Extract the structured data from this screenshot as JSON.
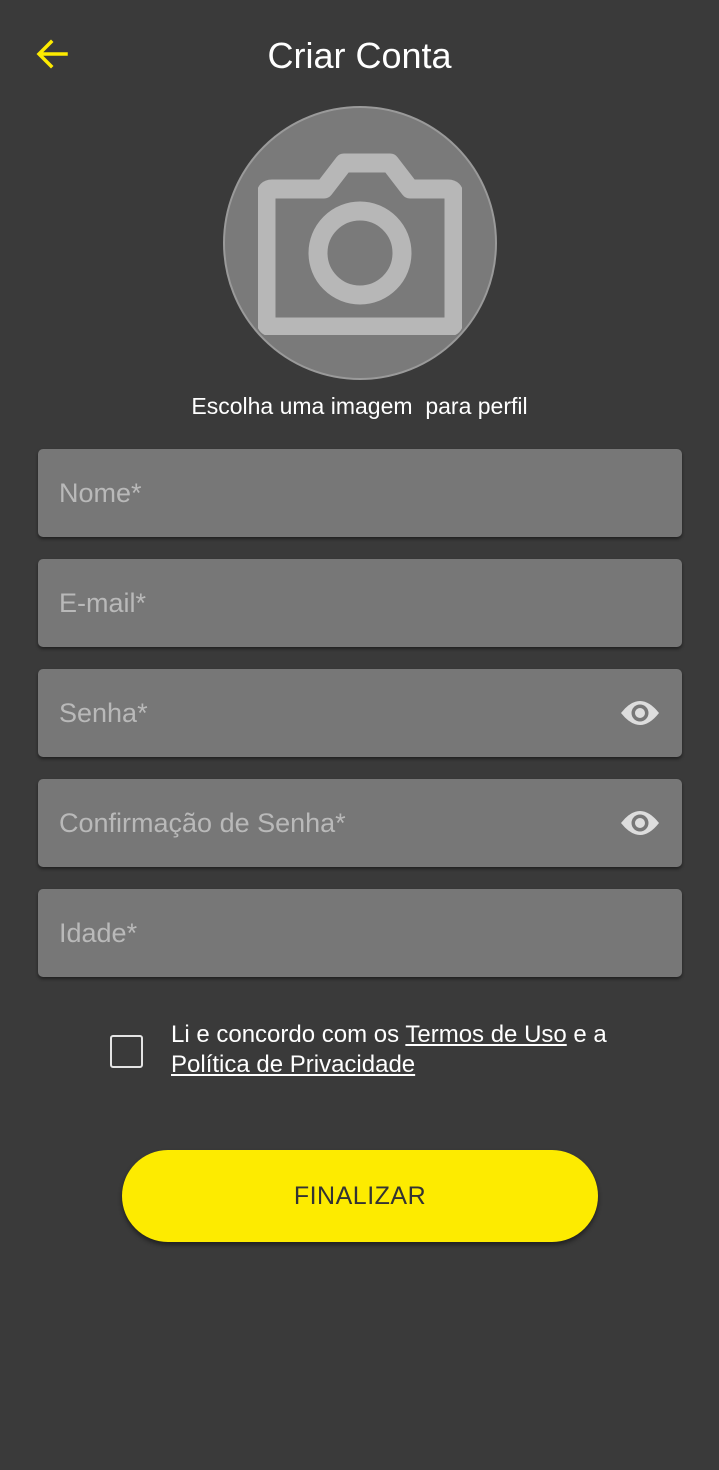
{
  "header": {
    "title": "Criar Conta",
    "back_icon": "arrow-left-icon"
  },
  "colors": {
    "background": "#3a3a3a",
    "accent": "#fdeb00",
    "field_bg": "#777777",
    "avatar_bg": "#7a7a7a"
  },
  "profile": {
    "icon": "camera-icon",
    "caption": "Escolha uma imagem  para perfil"
  },
  "form": {
    "name_placeholder": "Nome*",
    "email_placeholder": "E-mail*",
    "password_placeholder": "Senha*",
    "confirm_password_placeholder": "Confirmação de Senha*",
    "age_placeholder": "Idade*",
    "toggle_icon": "eye-icon"
  },
  "terms": {
    "prefix": "Li e concordo com os ",
    "terms_link": "Termos de Uso",
    "middle": " e a ",
    "privacy_link": "Política de Privacidade",
    "checked": false
  },
  "actions": {
    "finalize_label": "FINALIZAR"
  }
}
